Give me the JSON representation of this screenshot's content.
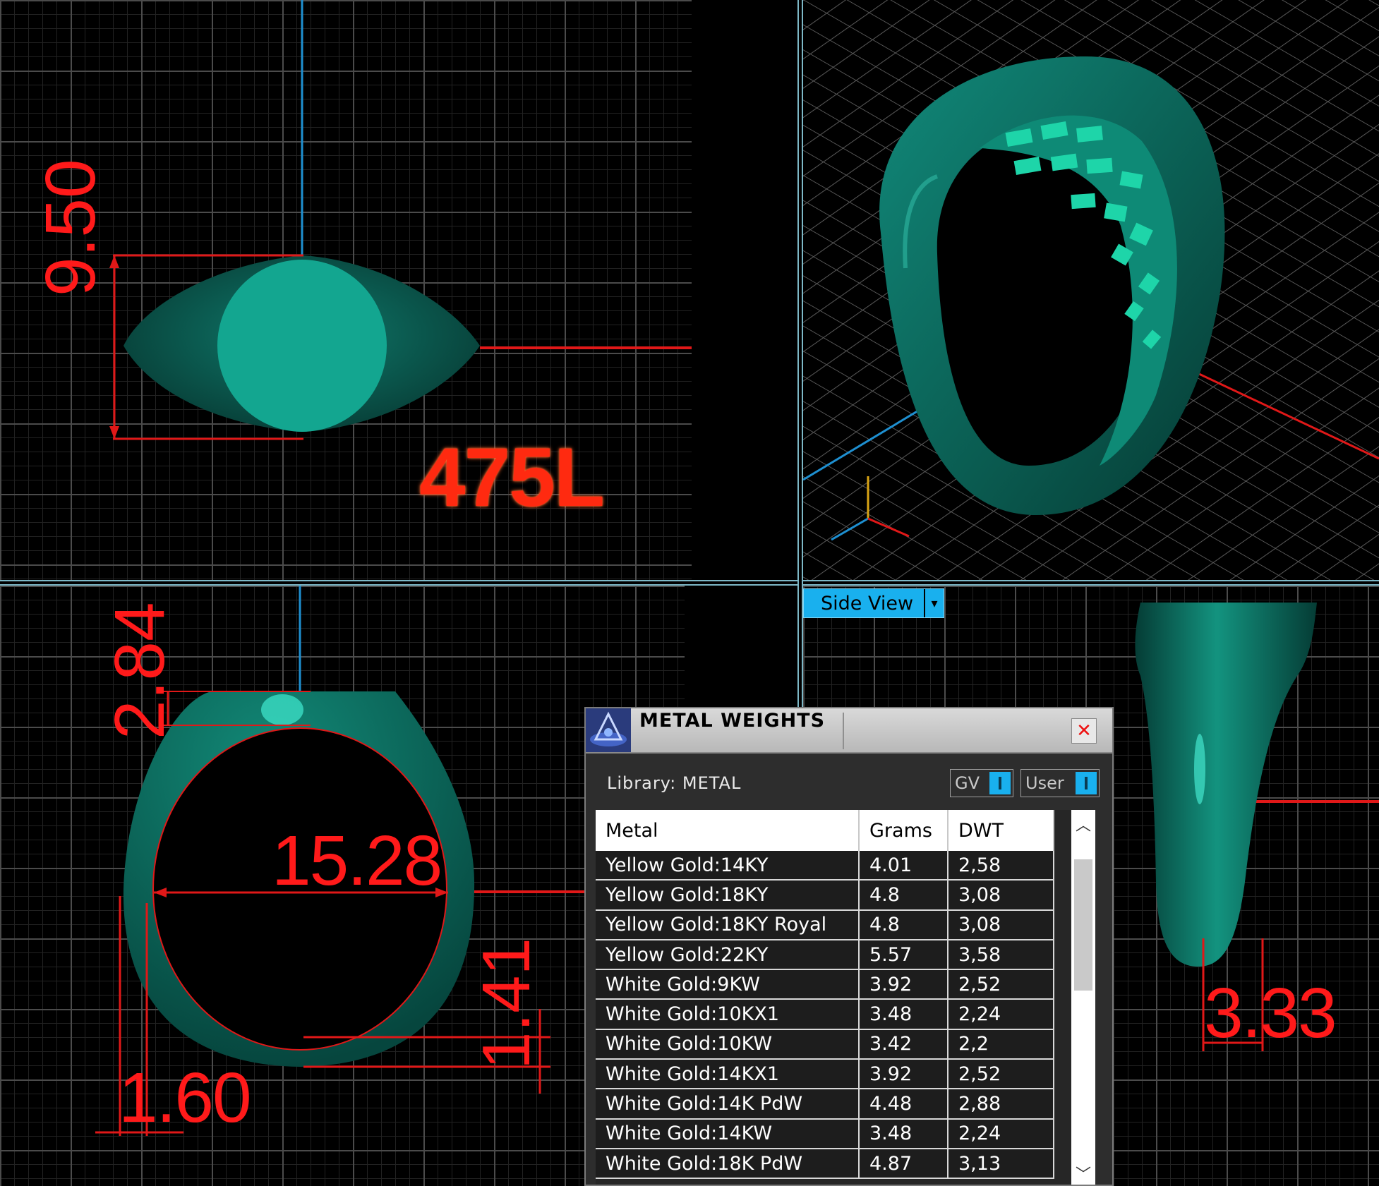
{
  "viewports": {
    "top_left": {
      "model_label": "475L",
      "dimension_height": "9.50"
    },
    "bottom_left": {
      "dimension_top": "2.84",
      "dimension_inner_diameter": "15.28",
      "dimension_bottom": "1.41",
      "dimension_shank": "1.60"
    },
    "bottom_right": {
      "view_name": "Side View",
      "dimension_width": "3.33"
    }
  },
  "metal_weights_panel": {
    "title": "METAL WEIGHTS",
    "close_label": "✕",
    "library_label": "Library: METAL",
    "toggles": [
      {
        "label": "GV"
      },
      {
        "label": "User"
      }
    ],
    "columns": [
      "Metal",
      "Grams",
      "DWT"
    ],
    "rows": [
      {
        "metal": "Yellow Gold:14KY",
        "grams": "4.01",
        "dwt": "2,58"
      },
      {
        "metal": "Yellow Gold:18KY",
        "grams": "4.8",
        "dwt": "3,08"
      },
      {
        "metal": "Yellow Gold:18KY Royal",
        "grams": "4.8",
        "dwt": "3,08"
      },
      {
        "metal": "Yellow Gold:22KY",
        "grams": "5.57",
        "dwt": "3,58"
      },
      {
        "metal": "White Gold:9KW",
        "grams": "3.92",
        "dwt": "2,52"
      },
      {
        "metal": "White Gold:10KX1",
        "grams": "3.48",
        "dwt": "2,24"
      },
      {
        "metal": "White Gold:10KW",
        "grams": "3.42",
        "dwt": "2,2"
      },
      {
        "metal": "White Gold:14KX1",
        "grams": "3.92",
        "dwt": "2,52"
      },
      {
        "metal": "White Gold:14K PdW",
        "grams": "4.48",
        "dwt": "2,88"
      },
      {
        "metal": "White Gold:14KW",
        "grams": "3.48",
        "dwt": "2,24"
      },
      {
        "metal": "White Gold:18K PdW",
        "grams": "4.87",
        "dwt": "3,13"
      }
    ]
  },
  "colors": {
    "model_teal": "#0f6e62",
    "face_teal": "#13a690",
    "dimension_red": "#ff1a1a",
    "axis_blue": "#1e8fd0",
    "ui_blue": "#19b0ee"
  }
}
